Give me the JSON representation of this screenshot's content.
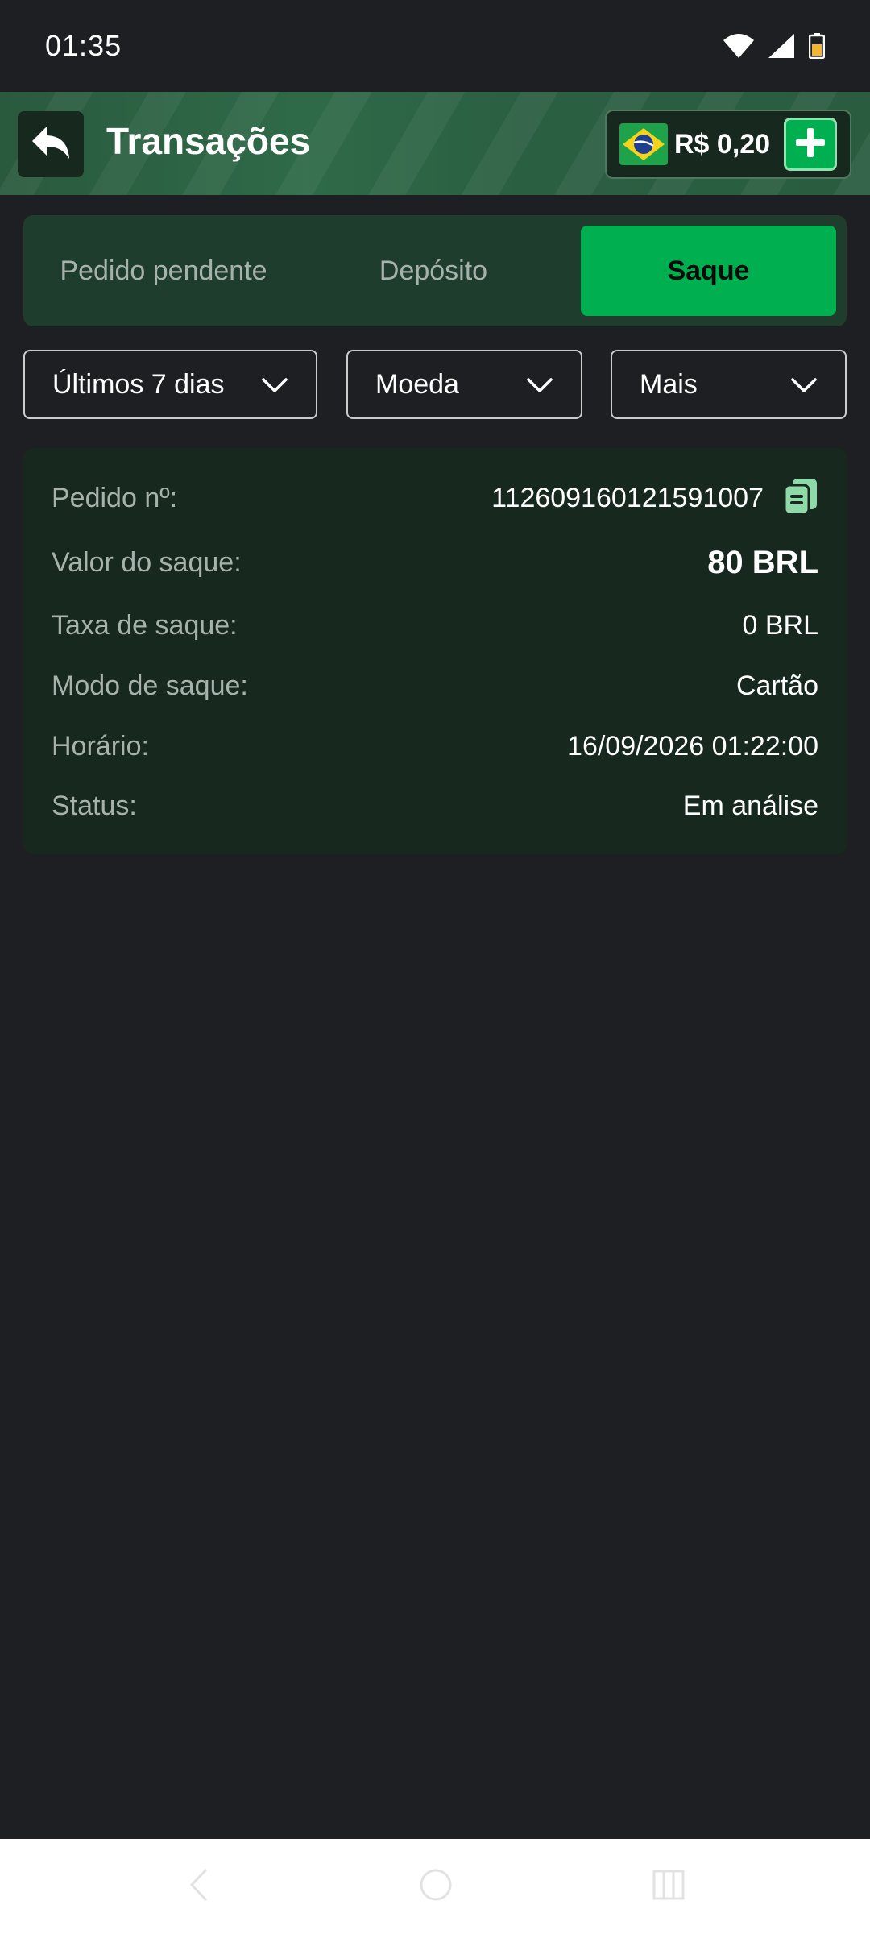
{
  "status_bar": {
    "time": "01:35",
    "icons": [
      "wifi-icon",
      "cellular-signal-icon",
      "battery-icon"
    ]
  },
  "header": {
    "title": "Transações",
    "back_icon": "reply-arrow-icon",
    "balance": "R$ 0,20",
    "flag_icon": "brazil-flag-icon",
    "add_icon": "plus-icon"
  },
  "tabs": [
    {
      "label": "Pedido pendente",
      "active": false
    },
    {
      "label": "Depósito",
      "active": false
    },
    {
      "label": "Saque",
      "active": true
    }
  ],
  "filters": {
    "period": "Últimos 7 dias",
    "currency": "Moeda",
    "more": "Mais"
  },
  "transaction": {
    "order_label": "Pedido nº:",
    "order_value": "112609160121591007",
    "amount_label": "Valor do saque:",
    "amount_value": "80 BRL",
    "fee_label": "Taxa de saque:",
    "fee_value": "0 BRL",
    "mode_label": "Modo de saque:",
    "mode_value": "Cartão",
    "time_label": "Horário:",
    "time_value": "16/09/2026 01:22:00",
    "status_label": "Status:",
    "status_value": "Em análise",
    "copy_icon": "copy-icon"
  },
  "nav_bar": {
    "icons": [
      "back-icon",
      "home-icon",
      "recents-icon"
    ]
  },
  "colors": {
    "background": "#1e1f23",
    "header_green": "#2e6a48",
    "accent_green": "#00b050",
    "card_bg": "#17291f",
    "tabs_bg": "#1f3d2c"
  }
}
